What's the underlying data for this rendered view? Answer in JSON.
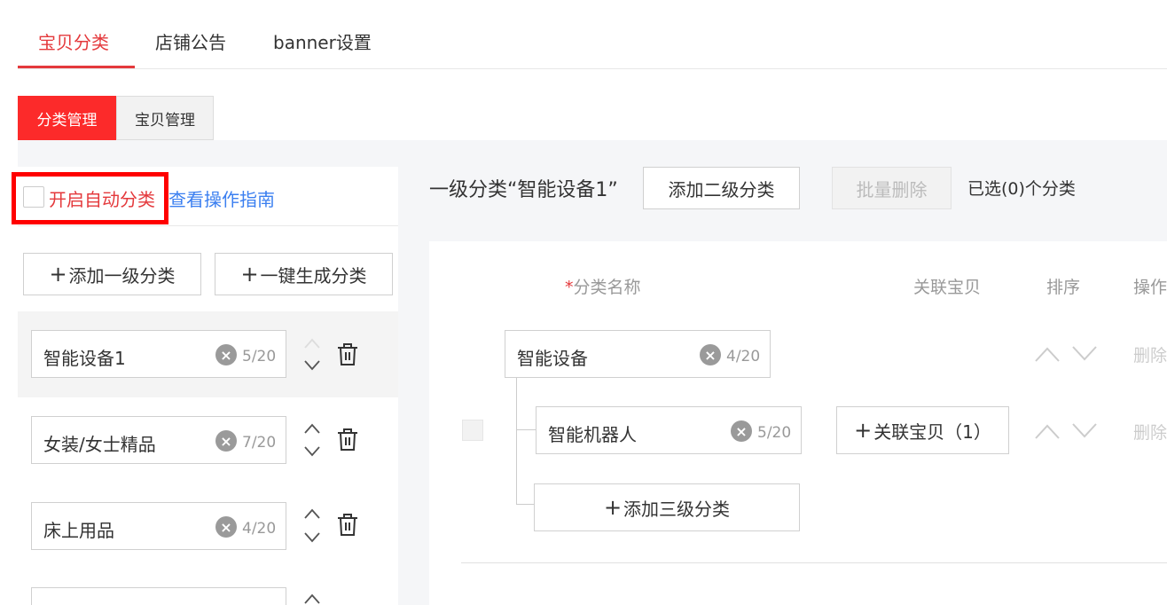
{
  "tabs": [
    {
      "label": "宝贝分类",
      "active": true
    },
    {
      "label": "店铺公告",
      "active": false
    },
    {
      "label": "banner设置",
      "active": false
    }
  ],
  "subtabs": [
    {
      "label": "分类管理",
      "active": true
    },
    {
      "label": "宝贝管理",
      "active": false
    }
  ],
  "left": {
    "auto_label": "开启自动分类",
    "guide_link": "查看操作指南",
    "add_first_label": "添加一级分类",
    "generate_label": "一键生成分类",
    "categories": [
      {
        "name": "智能设备1",
        "count": "5/20"
      },
      {
        "name": "女装/女士精品",
        "count": "7/20"
      },
      {
        "name": "床上用品",
        "count": "4/20"
      }
    ]
  },
  "right": {
    "title": "一级分类“智能设备1”",
    "add_second_label": "添加二级分类",
    "batch_delete_label": "批量删除",
    "selected_text": "已选(0)个分类",
    "columns": {
      "name": "分类名称",
      "linked": "关联宝贝",
      "sort": "排序",
      "ops": "操作"
    },
    "second_level": {
      "name": "智能设备",
      "count": "4/20",
      "delete": "删除"
    },
    "third_level": {
      "name": "智能机器人",
      "count": "5/20",
      "link_label": "关联宝贝（1）",
      "delete": "删除"
    },
    "add_third_label": "添加三级分类"
  },
  "colors": {
    "accent": "#e4393c",
    "link": "#3b7ff0"
  }
}
